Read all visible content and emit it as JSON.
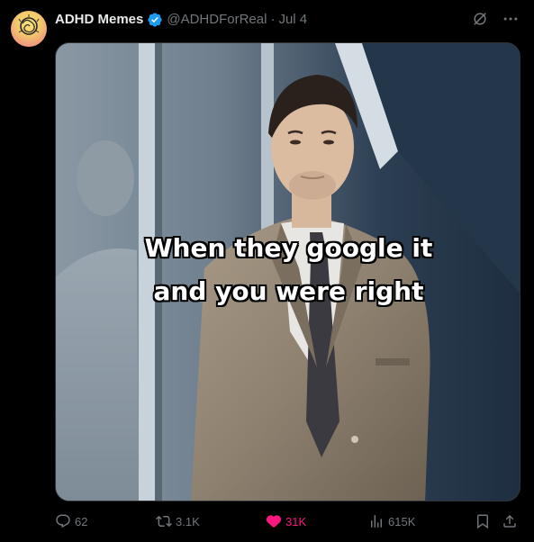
{
  "tweet": {
    "author_name": "ADHD Memes",
    "handle": "@ADHDForReal",
    "separator": "·",
    "date": "Jul 4",
    "verified": true,
    "caption_line1": "When they google it",
    "caption_line2": "and you were right",
    "stats": {
      "replies": "62",
      "reposts": "3.1K",
      "likes": "31K",
      "views": "615K"
    },
    "liked": true
  },
  "icons": {
    "avatar": "avatar-image",
    "verified": "verified-badge-icon",
    "grok": "grok-icon",
    "more": "more-icon",
    "reply": "reply-icon",
    "repost": "repost-icon",
    "like": "heart-icon",
    "views": "views-icon",
    "bookmark": "bookmark-icon",
    "share": "share-icon"
  },
  "colors": {
    "background": "#000000",
    "text": "#e7e9ea",
    "muted": "#71767b",
    "verified": "#1d9bf0",
    "like": "#f91880"
  }
}
